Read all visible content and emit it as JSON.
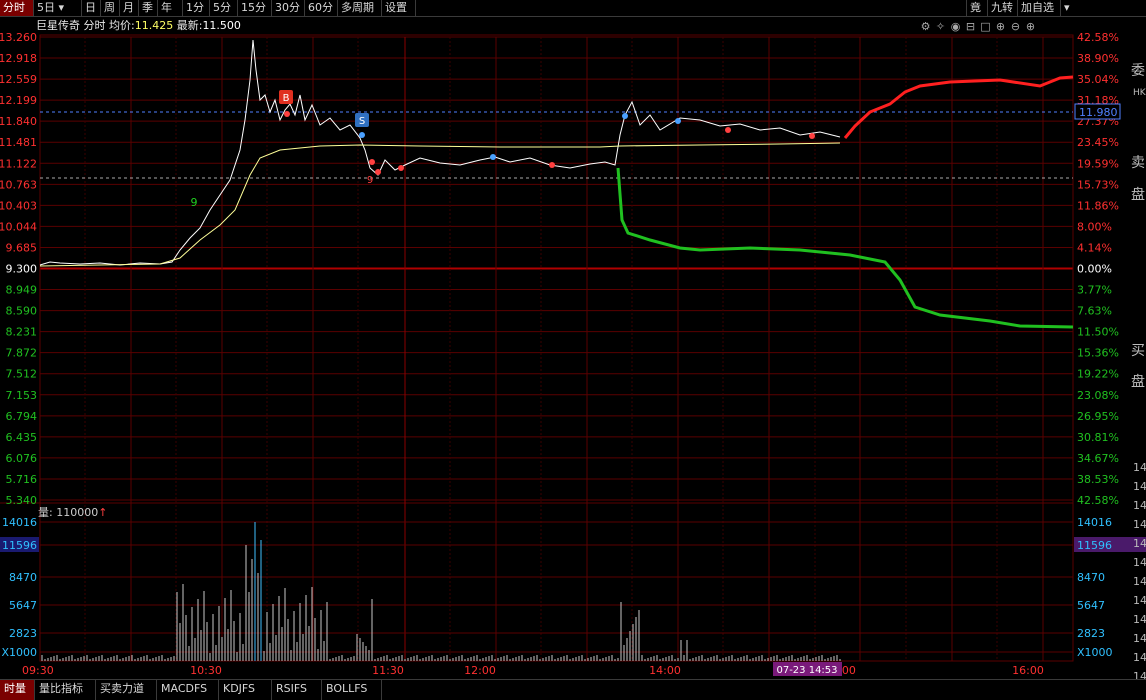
{
  "toolbar": {
    "tabs": [
      "分时",
      "5日",
      "日",
      "周",
      "月",
      "季",
      "年",
      "1分",
      "5分",
      "15分",
      "30分",
      "60分",
      "多周期",
      "设置"
    ],
    "active": "分时",
    "right": [
      "竟",
      "九转",
      "加自选"
    ]
  },
  "info": {
    "name": "巨星传奇",
    "mode": "分时",
    "avg_label": "均价:",
    "avg_value": "11.425",
    "last_label": "最新:",
    "last_value": "11.500"
  },
  "price_axis": {
    "left": [
      "13.260",
      "12.918",
      "12.559",
      "12.199",
      "11.840",
      "11.481",
      "11.122",
      "10.763",
      "10.403",
      "10.044",
      "9.685",
      "9.300",
      "8.949",
      "8.590",
      "8.231",
      "7.872",
      "7.512",
      "7.153",
      "6.794",
      "6.435",
      "6.076",
      "5.716",
      "5.340"
    ],
    "right": [
      "42.58%",
      "38.90%",
      "35.04%",
      "31.18%",
      "27.37%",
      "23.45%",
      "19.59%",
      "15.73%",
      "11.86%",
      "8.00%",
      "4.14%",
      "0.00%",
      "3.77%",
      "7.63%",
      "11.50%",
      "15.36%",
      "19.22%",
      "23.08%",
      "26.95%",
      "30.81%",
      "34.67%",
      "38.53%",
      "42.58%"
    ],
    "price_tag": "11.980"
  },
  "volume": {
    "label": "量:",
    "value": "110000",
    "arrow": "↑",
    "left_axis": [
      "14016",
      "11596",
      "8470",
      "5647",
      "2823",
      "X1000"
    ],
    "right_axis": [
      "14016",
      "11596",
      "8470",
      "5647",
      "2823",
      "X1000"
    ]
  },
  "time_axis": [
    "09:30",
    "10:30",
    "11:30",
    "12:00",
    "14:00",
    ":00",
    "16:00"
  ],
  "cursor_label": "07-23 14:53",
  "markers": {
    "buy": "B",
    "sell": "S",
    "nine": "9"
  },
  "bottom_tabs": [
    "时量",
    "量比指标",
    "买卖力道",
    "MACDFS",
    "KDJFS",
    "RSIFS",
    "BOLLFS"
  ],
  "side": {
    "chars": [
      "委",
      "卖",
      "盘",
      "买",
      "盘"
    ],
    "hk": "HK",
    "nums": [
      "14",
      "14",
      "14",
      "14",
      "14",
      "14",
      "14",
      "14",
      "14",
      "14",
      "14",
      "14"
    ]
  },
  "colors": {
    "grid": "#5a0000",
    "price_line": "#ffffff",
    "avg_line": "#ffff99",
    "sell_pressure": "#ff2020",
    "buy_pressure": "#20c020",
    "axis_up": "#ff3030",
    "axis_down": "#20c020",
    "volume_bar": "#c8c8c8",
    "volume_peak": "#40c0ff"
  }
}
